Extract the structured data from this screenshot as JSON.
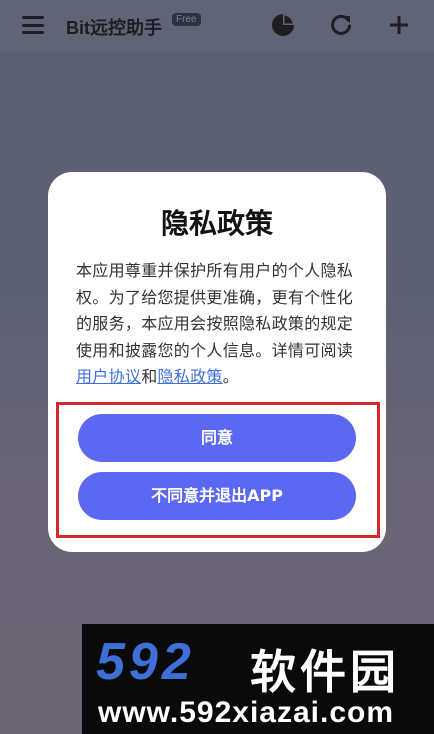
{
  "appbar": {
    "title": "Bit远控助手",
    "badge": "Free",
    "icons": [
      "menu-icon",
      "pie-chart-icon",
      "refresh-icon",
      "plus-icon"
    ]
  },
  "dialog": {
    "title": "隐私政策",
    "body_text": "本应用尊重并保护所有用户的个人隐私权。为了给您提供更准确，更有个性化的服务，本应用会按照隐私政策的规定使用和披露您的个人信息。详情可阅读",
    "link_user_agreement": "用户协议",
    "conjunction": "和",
    "link_privacy_policy": "隐私政策",
    "period": "。",
    "agree_label": "同意",
    "decline_label": "不同意并退出APP"
  },
  "watermark": {
    "logo": "592",
    "name": "软件园",
    "url": "www.592xiazai.com"
  },
  "colors": {
    "button": "#5b68f2",
    "link": "#3f6fe0",
    "highlight": "#d4282b",
    "logo": "#3d6fd6"
  }
}
